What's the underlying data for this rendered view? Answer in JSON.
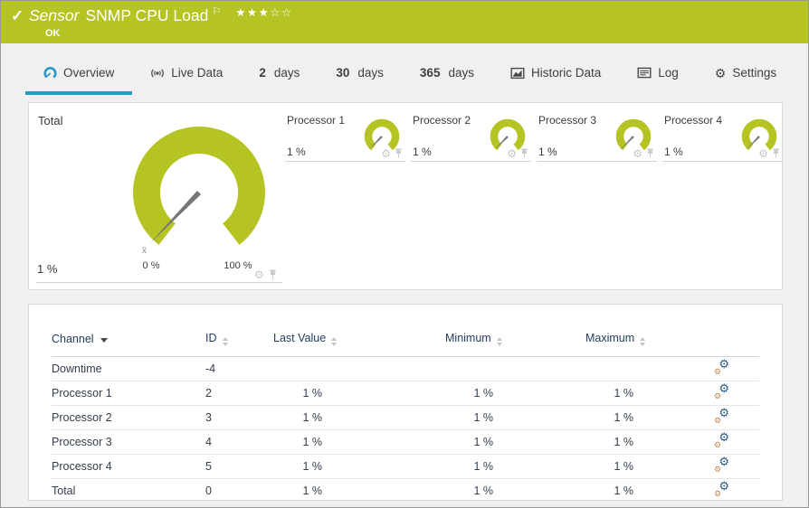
{
  "header": {
    "sensor_label": "Sensor",
    "title": "SNMP CPU Load",
    "status": "OK",
    "rating_stars": "★★★☆☆"
  },
  "icons": {
    "check": "✓",
    "flag": "⚐",
    "gear": "⚙"
  },
  "tabs": [
    {
      "label": "Overview",
      "active": true
    },
    {
      "label": "Live Data"
    },
    {
      "prefix": "2",
      "label": "days"
    },
    {
      "prefix": "30",
      "label": "days"
    },
    {
      "prefix": "365",
      "label": "days"
    },
    {
      "label": "Historic Data"
    },
    {
      "label": "Log"
    },
    {
      "label": "Settings"
    }
  ],
  "gauges": {
    "total": {
      "title": "Total",
      "value": "1 %",
      "scale_min": "0 %",
      "scale_max": "100 %",
      "mean_marker": "x̄"
    },
    "processors": [
      {
        "title": "Processor 1",
        "value": "1 %"
      },
      {
        "title": "Processor 2",
        "value": "1 %"
      },
      {
        "title": "Processor 3",
        "value": "1 %"
      },
      {
        "title": "Processor 4",
        "value": "1 %"
      }
    ]
  },
  "table": {
    "headers": {
      "channel": "Channel",
      "id": "ID",
      "last_value": "Last Value",
      "minimum": "Minimum",
      "maximum": "Maximum"
    },
    "rows": [
      {
        "channel": "Downtime",
        "id": "-4",
        "last": "",
        "min": "",
        "max": ""
      },
      {
        "channel": "Processor 1",
        "id": "2",
        "last": "1 %",
        "min": "1 %",
        "max": "1 %"
      },
      {
        "channel": "Processor 2",
        "id": "3",
        "last": "1 %",
        "min": "1 %",
        "max": "1 %"
      },
      {
        "channel": "Processor 3",
        "id": "4",
        "last": "1 %",
        "min": "1 %",
        "max": "1 %"
      },
      {
        "channel": "Processor 4",
        "id": "5",
        "last": "1 %",
        "min": "1 %",
        "max": "1 %"
      },
      {
        "channel": "Total",
        "id": "0",
        "last": "1 %",
        "min": "1 %",
        "max": "1 %"
      }
    ]
  },
  "colors": {
    "status_green": "#b5c423",
    "tab_active_blue": "#2798c8",
    "needle_gray": "#757575"
  }
}
